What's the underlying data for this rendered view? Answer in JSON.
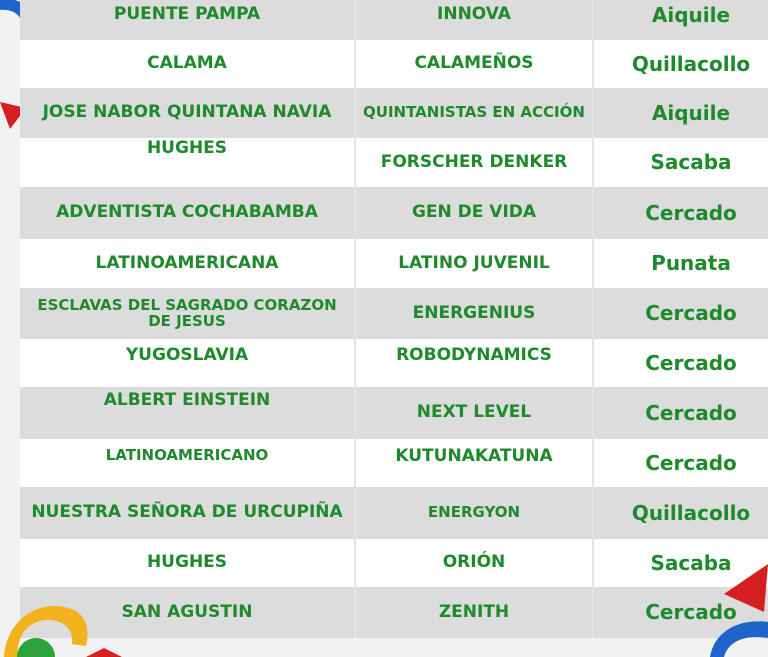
{
  "rows": [
    {
      "school": "PUENTE PAMPA",
      "team": "INNOVA",
      "municipality": "Aiquile"
    },
    {
      "school": "CALAMA",
      "team": "CALAMEÑOS",
      "municipality": "Quillacollo"
    },
    {
      "school": "JOSE NABOR QUINTANA NAVIA",
      "team": "QUINTANISTAS EN ACCIÓN",
      "municipality": "Aiquile"
    },
    {
      "school": "HUGHES",
      "team": "FORSCHER DENKER",
      "municipality": "Sacaba"
    },
    {
      "school": "ADVENTISTA COCHABAMBA",
      "team": "GEN DE VIDA",
      "municipality": "Cercado"
    },
    {
      "school": "LATINOAMERICANA",
      "team": "LATINO JUVENIL",
      "municipality": "Punata"
    },
    {
      "school": "ESCLAVAS DEL SAGRADO CORAZON DE JESUS",
      "team": "ENERGENIUS",
      "municipality": "Cercado"
    },
    {
      "school": "YUGOSLAVIA",
      "team": "ROBODYNAMICS",
      "municipality": "Cercado"
    },
    {
      "school": "ALBERT EINSTEIN",
      "team": "NEXT LEVEL",
      "municipality": "Cercado"
    },
    {
      "school": "LATINOAMERICANO",
      "team": "KUTUNAKATUNA",
      "municipality": "Cercado"
    },
    {
      "school": "NUESTRA SEÑORA DE URCUPIÑA",
      "team": "ENERGYON",
      "municipality": "Quillacollo"
    },
    {
      "school": "HUGHES",
      "team": "ORIÓN",
      "municipality": "Sacaba"
    },
    {
      "school": "SAN AGUSTIN",
      "team": "ZENITH",
      "municipality": "Cercado"
    }
  ],
  "colors": {
    "text_green": "#1e8a2c",
    "row_gray": "#dcdcdc",
    "row_white": "#ffffff",
    "deco_blue": "#1f64c8",
    "deco_red": "#d42020",
    "deco_yellow": "#f2b21b",
    "deco_green": "#2aa33a"
  }
}
